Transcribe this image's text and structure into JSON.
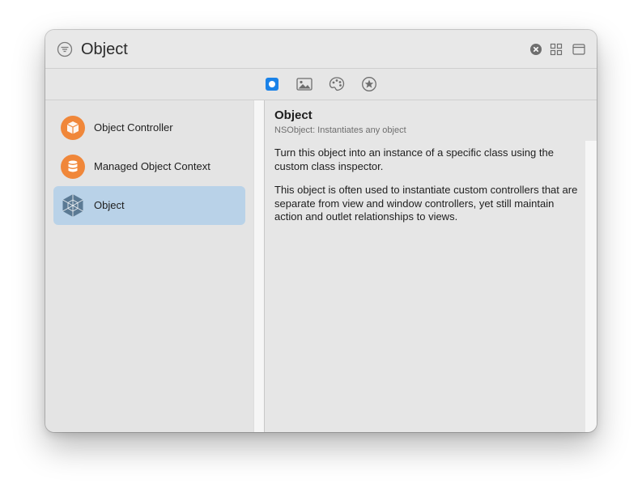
{
  "search": {
    "value": "Object",
    "filter_icon": "filter-icon",
    "clear_icon": "clear-icon"
  },
  "toolbar": {
    "grid_icon": "grid-view-icon",
    "layout_icon": "sidebar-layout-icon"
  },
  "tabs": [
    {
      "icon": "objects-library-icon",
      "selected": true
    },
    {
      "icon": "image-library-icon",
      "selected": false
    },
    {
      "icon": "color-palette-icon",
      "selected": false
    },
    {
      "icon": "symbols-library-icon",
      "selected": false
    }
  ],
  "library_items": [
    {
      "label": "Object Controller",
      "icon": "cube-icon",
      "color": "#f0873a",
      "selected": false
    },
    {
      "label": "Managed Object Context",
      "icon": "database-icon",
      "color": "#f0873a",
      "selected": false
    },
    {
      "label": "Object",
      "icon": "wireframe-cube-icon",
      "color": "#5b7a94",
      "selected": true
    }
  ],
  "detail": {
    "title": "Object",
    "subtitle": "NSObject: Instantiates any object",
    "paragraphs": [
      "Turn this object into an instance of a specific class using the custom class inspector.",
      "This object is often used to instantiate custom controllers that are separate from view and window controllers, yet still maintain action and outlet relationships to views."
    ]
  },
  "colors": {
    "accent": "#1a82e8",
    "selection": "#b9d2e8",
    "orange_icon": "#f0873a",
    "slate_icon": "#5b7a94"
  }
}
